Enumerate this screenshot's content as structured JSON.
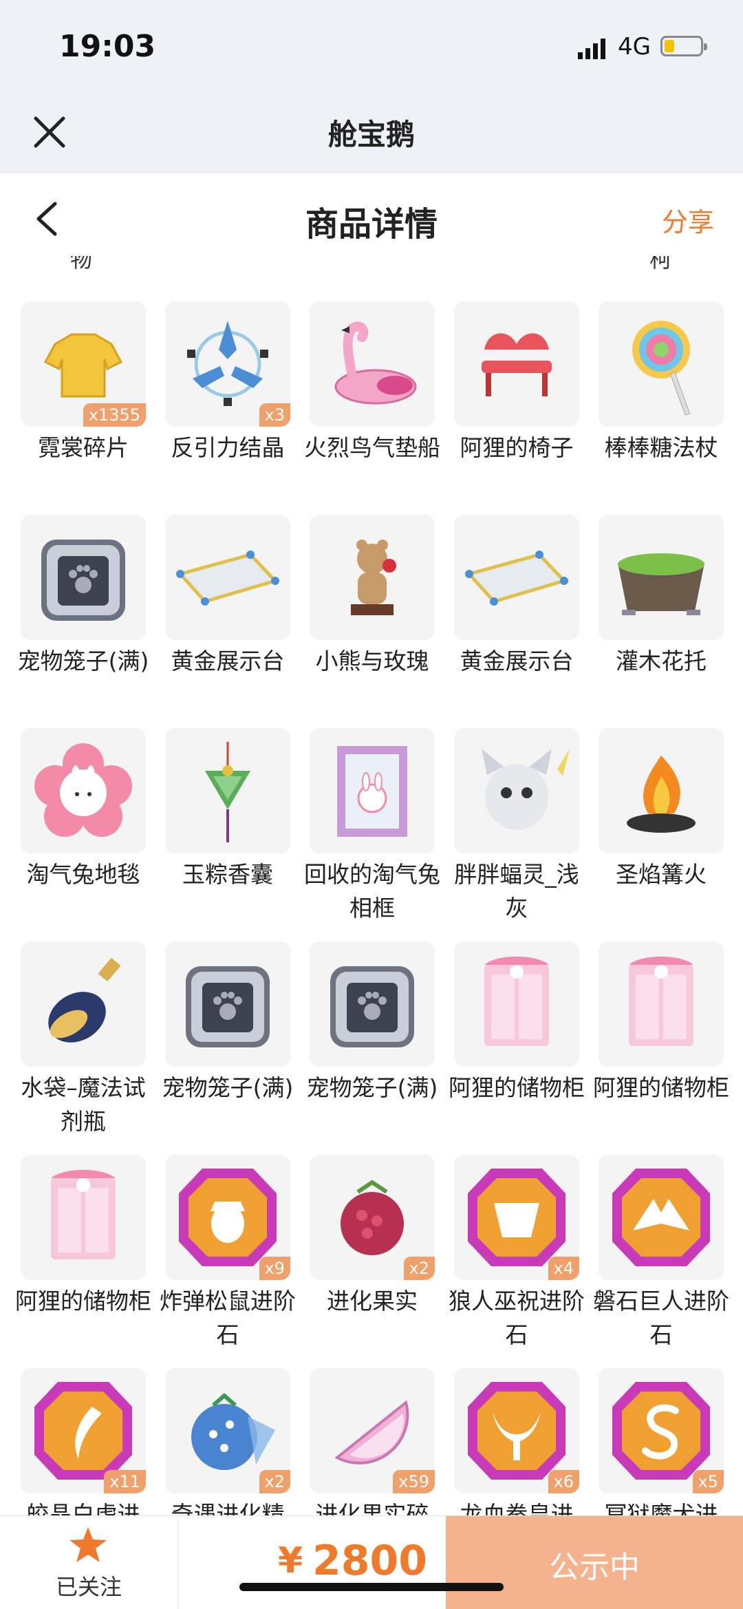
{
  "status": {
    "time": "19:03",
    "network": "4G"
  },
  "app": {
    "title": "舱宝鹅"
  },
  "nav": {
    "title": "商品详情",
    "share": "分享"
  },
  "partial_labels": [
    "物",
    "柯"
  ],
  "items": [
    {
      "name": "霓裳碎片",
      "badge": "x1355",
      "icon": "golden-shirt-icon"
    },
    {
      "name": "反引力结晶",
      "badge": "x3",
      "icon": "anti-gravity-crystal-icon"
    },
    {
      "name": "火烈鸟气垫船",
      "badge": "",
      "icon": "flamingo-float-icon"
    },
    {
      "name": "阿狸的椅子",
      "badge": "",
      "icon": "ali-chair-icon"
    },
    {
      "name": "棒棒糖法杖",
      "badge": "",
      "icon": "lollipop-wand-icon"
    },
    {
      "name": "宠物笼子(满)",
      "badge": "",
      "icon": "pet-cage-icon"
    },
    {
      "name": "黄金展示台",
      "badge": "",
      "icon": "gold-display-stand-icon"
    },
    {
      "name": "小熊与玫瑰",
      "badge": "",
      "icon": "bear-rose-icon"
    },
    {
      "name": "黄金展示台",
      "badge": "",
      "icon": "gold-display-stand-icon"
    },
    {
      "name": "灌木花托",
      "badge": "",
      "icon": "shrub-planter-icon"
    },
    {
      "name": "淘气兔地毯",
      "badge": "",
      "icon": "bunny-rug-icon"
    },
    {
      "name": "玉粽香囊",
      "badge": "",
      "icon": "jade-sachet-icon"
    },
    {
      "name": "回收的淘气兔相框",
      "badge": "",
      "icon": "bunny-frame-icon"
    },
    {
      "name": "胖胖蝠灵_浅灰",
      "badge": "",
      "icon": "bat-spirit-icon"
    },
    {
      "name": "圣焰篝火",
      "badge": "",
      "icon": "bonfire-icon"
    },
    {
      "name": "水袋–魔法试剂瓶",
      "badge": "",
      "icon": "potion-bottle-icon"
    },
    {
      "name": "宠物笼子(满)",
      "badge": "",
      "icon": "pet-cage-icon"
    },
    {
      "name": "宠物笼子(满)",
      "badge": "",
      "icon": "pet-cage-icon"
    },
    {
      "name": "阿狸的储物柜",
      "badge": "",
      "icon": "ali-cabinet-icon"
    },
    {
      "name": "阿狸的储物柜",
      "badge": "",
      "icon": "ali-cabinet-icon"
    },
    {
      "name": "阿狸的储物柜",
      "badge": "",
      "icon": "ali-cabinet-icon"
    },
    {
      "name": "炸弹松鼠进阶石",
      "badge": "x9",
      "icon": "advance-stone-acorn-icon"
    },
    {
      "name": "进化果实",
      "badge": "x2",
      "icon": "evolution-fruit-icon"
    },
    {
      "name": "狼人巫祝进阶石",
      "badge": "x4",
      "icon": "advance-stone-mask-icon"
    },
    {
      "name": "磐石巨人进阶石",
      "badge": "",
      "icon": "advance-stone-rock-icon"
    },
    {
      "name": "皎晶白虎进",
      "badge": "x11",
      "icon": "advance-stone-claw-icon"
    },
    {
      "name": "奇遇进化精",
      "badge": "x2",
      "icon": "blue-berry-icon"
    },
    {
      "name": "进化果实碎",
      "badge": "x59",
      "icon": "fruit-slice-icon"
    },
    {
      "name": "龙血拳皇进",
      "badge": "x6",
      "icon": "advance-stone-horns-icon"
    },
    {
      "name": "冥狱魔犬进",
      "badge": "x5",
      "icon": "advance-stone-s-icon"
    }
  ],
  "bottom": {
    "follow_label": "已关注",
    "currency": "¥",
    "price": "2800",
    "action_label": "公示中"
  },
  "colors": {
    "accent": "#f07a2c",
    "action_bg": "#f4b38c",
    "badge_bg": "#f0a06a",
    "header_bg": "#eef1f5"
  }
}
